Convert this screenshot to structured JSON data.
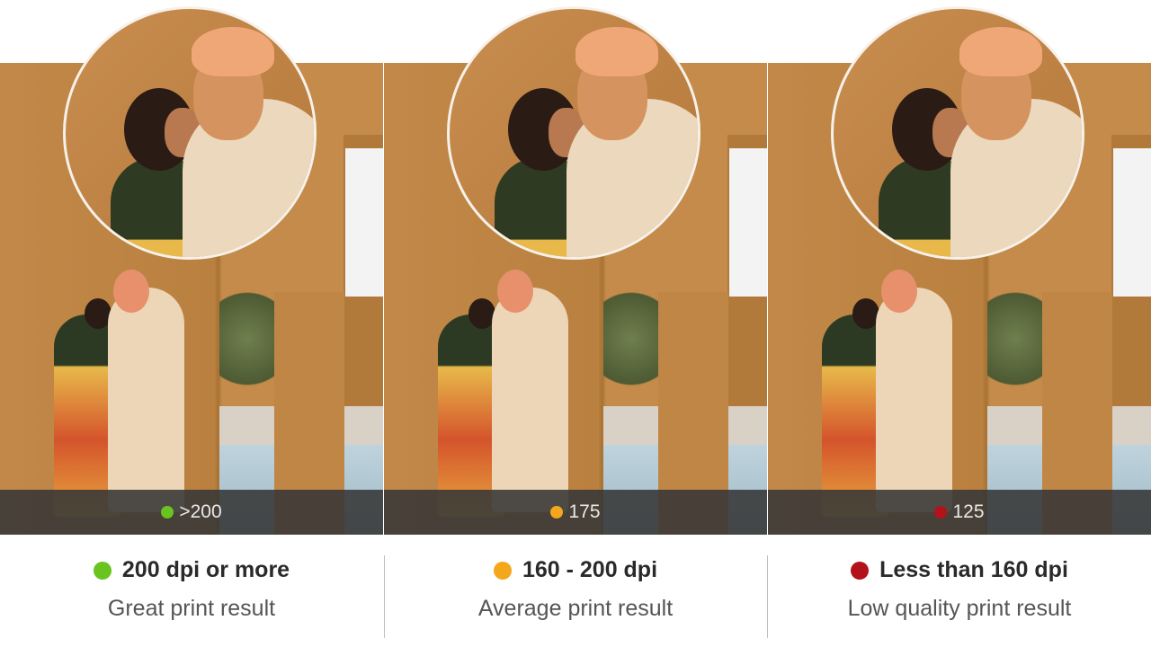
{
  "panels": [
    {
      "dpi_value": ">200",
      "dot_color": "#6ac41f",
      "heading": "200 dpi or more",
      "description": "Great print result"
    },
    {
      "dpi_value": "175",
      "dot_color": "#f4a71b",
      "heading": "160 - 200 dpi",
      "description": "Average print result"
    },
    {
      "dpi_value": "125",
      "dot_color": "#b3121a",
      "heading": "Less than 160 dpi",
      "description": "Low quality print result"
    }
  ]
}
